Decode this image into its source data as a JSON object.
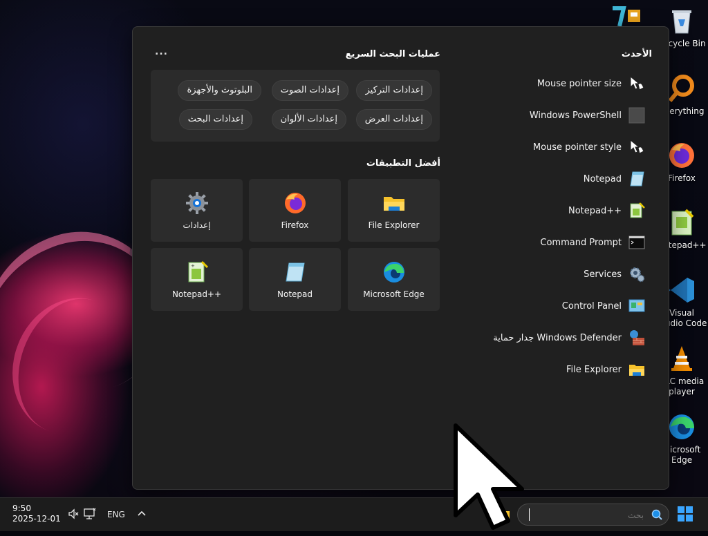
{
  "desktop_icons": [
    {
      "label": "Recycle Bin",
      "icon": "recycle-bin-icon"
    },
    {
      "label": "Everything",
      "icon": "everything-search-icon"
    },
    {
      "label": "Firefox",
      "icon": "firefox-icon"
    },
    {
      "label": "Notepad++",
      "icon": "notepadplusplus-icon"
    },
    {
      "label": "Visual Studio Code",
      "icon": "vscode-icon"
    },
    {
      "label": "VLC media player",
      "icon": "vlc-icon"
    },
    {
      "label": "Microsoft Edge",
      "icon": "edge-icon"
    }
  ],
  "search_panel": {
    "recent": {
      "title": "الأحدث",
      "items": [
        {
          "label": "Mouse pointer size",
          "icon": "mouse-pointer-icon"
        },
        {
          "label": "Windows PowerShell",
          "icon": "powershell-icon"
        },
        {
          "label": "Mouse pointer style",
          "icon": "mouse-pointer-icon"
        },
        {
          "label": "Notepad",
          "icon": "notepad-icon"
        },
        {
          "label": "Notepad++",
          "icon": "notepadplusplus-icon"
        },
        {
          "label": "Command Prompt",
          "icon": "command-prompt-icon"
        },
        {
          "label": "Services",
          "icon": "services-gear-icon"
        },
        {
          "label": "Control Panel",
          "icon": "control-panel-icon"
        },
        {
          "label": "جدار حماية Windows Defender",
          "icon": "firewall-icon"
        },
        {
          "label": "File Explorer",
          "icon": "folder-icon"
        }
      ]
    },
    "quick_searches": {
      "title": "عمليات البحث السريع",
      "more_label": "...",
      "chips": [
        "إعدادات التركيز",
        "إعدادات الصوت",
        "البلوتوث والأجهزة",
        "إعدادات العرض",
        "إعدادات الألوان",
        "إعدادات البحث"
      ]
    },
    "top_apps": {
      "title": "أفضل التطبيقات",
      "tiles": [
        {
          "label": "File Explorer",
          "icon": "folder-icon"
        },
        {
          "label": "Firefox",
          "icon": "firefox-icon"
        },
        {
          "label": "إعدادات",
          "icon": "settings-gear-icon"
        },
        {
          "label": "Microsoft Edge",
          "icon": "edge-icon"
        },
        {
          "label": "Notepad",
          "icon": "notepad-icon"
        },
        {
          "label": "Notepad++",
          "icon": "notepadplusplus-icon"
        }
      ]
    }
  },
  "taskbar": {
    "time": "9:50",
    "date": "2025-12-01",
    "language": "ENG",
    "search_placeholder": "بحث",
    "tray_chevron": "^"
  }
}
